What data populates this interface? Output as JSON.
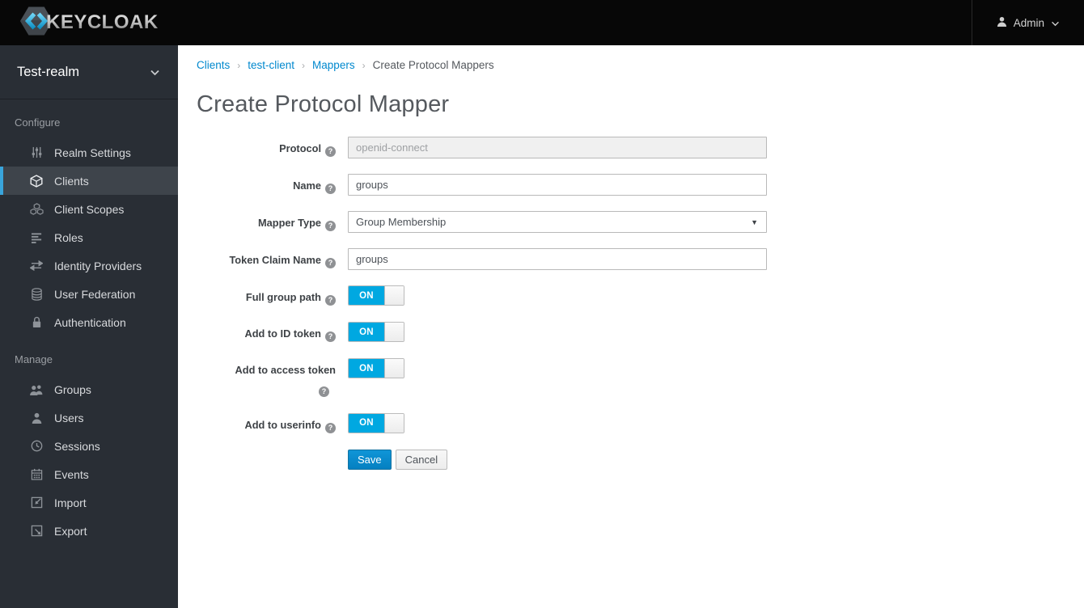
{
  "navbar": {
    "brand": "KEYCLOAK",
    "user_label": "Admin"
  },
  "sidebar": {
    "realm": "Test-realm",
    "sections": [
      {
        "label": "Configure",
        "items": [
          {
            "label": "Realm Settings",
            "icon": "sliders-icon",
            "active": false
          },
          {
            "label": "Clients",
            "icon": "cube-icon",
            "active": true
          },
          {
            "label": "Client Scopes",
            "icon": "cubes-icon",
            "active": false
          },
          {
            "label": "Roles",
            "icon": "list-icon",
            "active": false
          },
          {
            "label": "Identity Providers",
            "icon": "exchange-icon",
            "active": false
          },
          {
            "label": "User Federation",
            "icon": "database-icon",
            "active": false
          },
          {
            "label": "Authentication",
            "icon": "lock-icon",
            "active": false
          }
        ]
      },
      {
        "label": "Manage",
        "items": [
          {
            "label": "Groups",
            "icon": "users-icon",
            "active": false
          },
          {
            "label": "Users",
            "icon": "user-icon",
            "active": false
          },
          {
            "label": "Sessions",
            "icon": "clock-icon",
            "active": false
          },
          {
            "label": "Events",
            "icon": "calendar-icon",
            "active": false
          },
          {
            "label": "Import",
            "icon": "import-icon",
            "active": false
          },
          {
            "label": "Export",
            "icon": "export-icon",
            "active": false
          }
        ]
      }
    ]
  },
  "breadcrumb": [
    {
      "label": "Clients",
      "link": true
    },
    {
      "label": "test-client",
      "link": true
    },
    {
      "label": "Mappers",
      "link": true
    },
    {
      "label": "Create Protocol Mappers",
      "link": false
    }
  ],
  "page": {
    "title": "Create Protocol Mapper"
  },
  "form": {
    "fields": [
      {
        "label": "Protocol",
        "type": "text",
        "value": "openid-connect",
        "disabled": true,
        "help": true
      },
      {
        "label": "Name",
        "type": "text",
        "value": "groups",
        "disabled": false,
        "help": true
      },
      {
        "label": "Mapper Type",
        "type": "select",
        "value": "Group Membership",
        "disabled": false,
        "help": true
      },
      {
        "label": "Token Claim Name",
        "type": "text",
        "value": "groups",
        "disabled": false,
        "help": true
      },
      {
        "label": "Full group path",
        "type": "toggle",
        "value": "ON",
        "help": true
      },
      {
        "label": "Add to ID token",
        "type": "toggle",
        "value": "ON",
        "help": true
      },
      {
        "label": "Add to access token",
        "type": "toggle",
        "value": "ON",
        "help": true,
        "help_on_new_line": true
      },
      {
        "label": "Add to userinfo",
        "type": "toggle",
        "value": "ON",
        "help": true
      }
    ],
    "help_glyph": "?",
    "buttons": {
      "save": "Save",
      "cancel": "Cancel"
    }
  },
  "colors": {
    "accent": "#0088ce",
    "toggle_on": "#00a8e1",
    "active_nav_border": "#39a5dc",
    "navbar_bg": "#070707",
    "sidebar_bg": "#292e35"
  }
}
